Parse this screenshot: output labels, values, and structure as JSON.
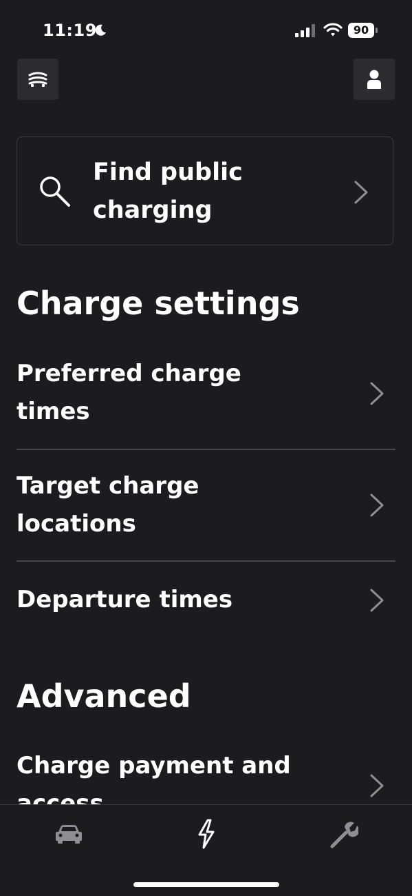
{
  "status_bar": {
    "time": "11:19",
    "battery": "90",
    "icons": [
      "moon-icon",
      "cellular-signal-icon",
      "wifi-icon",
      "battery-icon"
    ]
  },
  "header": {
    "left_icon": "garage-icon",
    "right_icon": "person-icon"
  },
  "find_card": {
    "icon": "search-icon",
    "label": "Find public charging"
  },
  "charge_settings": {
    "title": "Charge settings",
    "items": [
      {
        "label": "Preferred charge times"
      },
      {
        "label": "Target charge locations"
      },
      {
        "label": "Departure times"
      }
    ]
  },
  "advanced": {
    "title": "Advanced",
    "items": [
      {
        "label": "Charge payment and access"
      }
    ]
  },
  "tab_bar": {
    "tabs": [
      {
        "icon": "car-icon",
        "active": false
      },
      {
        "icon": "lightning-icon",
        "active": true
      },
      {
        "icon": "wrench-icon",
        "active": false
      }
    ]
  },
  "colors": {
    "background": "#1c1c1e",
    "surface": "#2c2c2e",
    "text": "#ffffff",
    "muted": "#8e8e93",
    "divider": "#48484a"
  }
}
